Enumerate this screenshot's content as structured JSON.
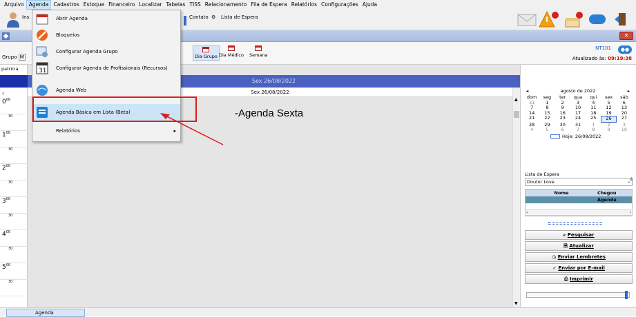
{
  "menubar": {
    "items": [
      "Arquivo",
      "Agenda",
      "Cadastros",
      "Estoque",
      "Financeiro",
      "Localizar",
      "Tabelas",
      "TISS",
      "Relacionamento",
      "Fila de Espera",
      "Relatórios",
      "Configurações",
      "Ajuda"
    ],
    "active_index": 1
  },
  "toolbar": {
    "ins_label": "Ins",
    "contact_label": "Contato",
    "waitlist_label": "Lista de Espera"
  },
  "dropdown": {
    "items": [
      {
        "label": "Abrir Agenda",
        "icon": "calendar-icon"
      },
      {
        "label": "Bloqueios",
        "icon": "block-icon"
      },
      {
        "label": "Configurar Agenda Grupo",
        "icon": "config-group-icon"
      },
      {
        "label": "Configurar Agenda de Profissionais (Recursos)",
        "icon": "calendar-31-icon"
      },
      {
        "label": "Agenda Web",
        "icon": "web-icon"
      },
      {
        "label": "Agenda Básica em Lista (Beta)",
        "icon": "list-agenda-icon",
        "highlighted": true
      },
      {
        "label": "Relatórios",
        "icon": "none",
        "submenu": true
      }
    ]
  },
  "subbar": {
    "grupo_label": "Grupo",
    "grupo_key": "M",
    "views": [
      {
        "label": "Dia Grupo",
        "active": true
      },
      {
        "label": "Dia Médico",
        "active": false
      },
      {
        "label": "Semana",
        "active": false
      }
    ],
    "user_code": "NT101",
    "updated_label": "Atualizado às:",
    "updated_time": "09:19:38"
  },
  "schedule": {
    "professional": "patricia",
    "date_header": "Sex 26/08/2022",
    "date_sub": "Sex 26/08/2022",
    "agenda_title": "-Agenda Sexta",
    "times": [
      {
        "hour": "0",
        "min": "00"
      },
      {
        "hour": "",
        "min": "30"
      },
      {
        "hour": "1",
        "min": "00"
      },
      {
        "hour": "",
        "min": "30"
      },
      {
        "hour": "2",
        "min": "00"
      },
      {
        "hour": "",
        "min": "30"
      },
      {
        "hour": "3",
        "min": "00"
      },
      {
        "hour": "",
        "min": "30"
      },
      {
        "hour": "4",
        "min": "00"
      },
      {
        "hour": "",
        "min": "30"
      },
      {
        "hour": "5",
        "min": "00"
      },
      {
        "hour": "",
        "min": "30"
      }
    ]
  },
  "calendar": {
    "month_label": "agosto de 2022",
    "weekdays": [
      "dom",
      "seg",
      "ter",
      "qua",
      "qui",
      "sex",
      "sáb"
    ],
    "days": [
      {
        "d": "31",
        "dim": true
      },
      {
        "d": "1"
      },
      {
        "d": "2"
      },
      {
        "d": "3"
      },
      {
        "d": "4"
      },
      {
        "d": "5"
      },
      {
        "d": "6"
      },
      {
        "d": "7"
      },
      {
        "d": "8"
      },
      {
        "d": "9"
      },
      {
        "d": "10"
      },
      {
        "d": "11"
      },
      {
        "d": "12"
      },
      {
        "d": "13"
      },
      {
        "d": "14"
      },
      {
        "d": "15"
      },
      {
        "d": "16"
      },
      {
        "d": "17"
      },
      {
        "d": "18"
      },
      {
        "d": "19"
      },
      {
        "d": "20"
      },
      {
        "d": "21"
      },
      {
        "d": "22"
      },
      {
        "d": "23"
      },
      {
        "d": "24"
      },
      {
        "d": "25"
      },
      {
        "d": "26",
        "sel": true
      },
      {
        "d": "27"
      },
      {
        "d": "28"
      },
      {
        "d": "29"
      },
      {
        "d": "30"
      },
      {
        "d": "31"
      },
      {
        "d": "1",
        "dim": true
      },
      {
        "d": "2",
        "dim": true
      },
      {
        "d": "3",
        "dim": true
      },
      {
        "d": "4",
        "dim": true
      },
      {
        "d": "5",
        "dim": true
      },
      {
        "d": "6",
        "dim": true
      },
      {
        "d": "7",
        "dim": true
      },
      {
        "d": "8",
        "dim": true
      },
      {
        "d": "9",
        "dim": true
      },
      {
        "d": "10",
        "dim": true
      }
    ],
    "today_label": "Hoje: 26/08/2022"
  },
  "waitlist": {
    "label": "Lista de Espera",
    "selected": "Doutor Love",
    "columns": [
      "Nome",
      "Chegou Agenda"
    ]
  },
  "actions": {
    "search": "Pesquisar",
    "refresh": "Atualizar",
    "reminders": "Enviar Lembretes",
    "email": "Enviar por E-mail",
    "print": "Imprimir"
  },
  "statusbar": {
    "tab_label": "Agenda"
  },
  "colors": {
    "accent_blue": "#4a61c2",
    "highlight": "#cce4f7",
    "annotation_red": "#e01b1b"
  }
}
